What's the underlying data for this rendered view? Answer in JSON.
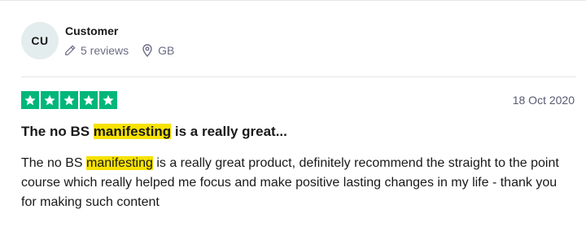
{
  "reviewer": {
    "initials": "CU",
    "name": "Customer",
    "reviews_count": "5 reviews",
    "country": "GB",
    "avatar_color": "#e4eded"
  },
  "review": {
    "rating": 5,
    "rating_max": 5,
    "star_color": "#00b67a",
    "date": "18 Oct 2020",
    "title": {
      "before": "The no BS ",
      "highlight": "manifesting",
      "after": " is a really great..."
    },
    "body": {
      "before": "The no BS ",
      "highlight": "manifesting",
      "after": " is a really great product, definitely recommend the straight to the point course which really helped me focus and make positive lasting changes in my life - thank you for making such content"
    },
    "highlight_color": "#f7e200"
  },
  "icons": {
    "reviews": "pencil-icon",
    "location": "location-pin-icon",
    "star": "star-icon"
  }
}
